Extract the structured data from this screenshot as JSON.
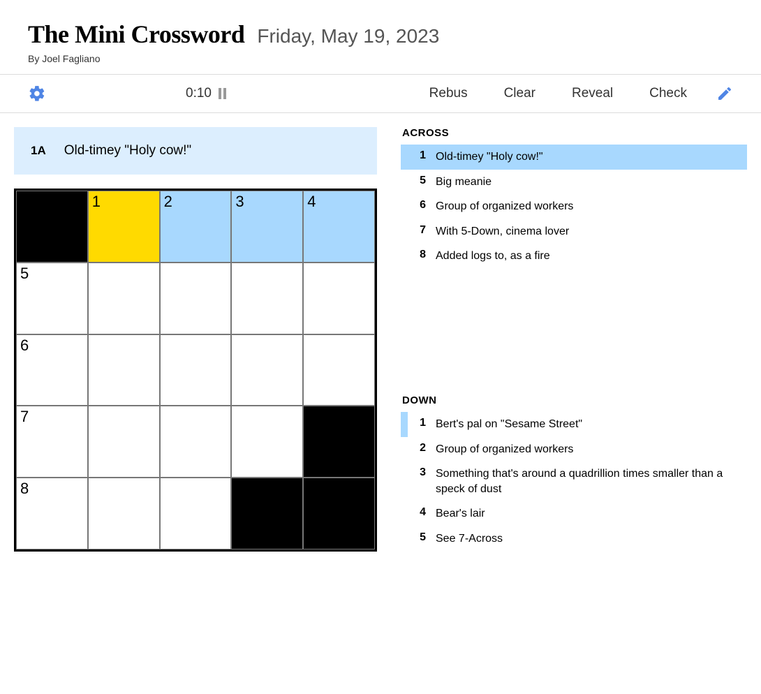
{
  "header": {
    "title": "The Mini Crossword",
    "date": "Friday, May 19, 2023",
    "byline": "By Joel Fagliano"
  },
  "toolbar": {
    "timer": "0:10",
    "menu": {
      "rebus": "Rebus",
      "clear": "Clear",
      "reveal": "Reveal",
      "check": "Check"
    }
  },
  "clue_bar": {
    "num": "1A",
    "text": "Old-timey \"Holy cow!\""
  },
  "grid": {
    "cells": [
      {
        "black": true
      },
      {
        "num": "1",
        "active": true
      },
      {
        "num": "2",
        "highlight": true
      },
      {
        "num": "3",
        "highlight": true
      },
      {
        "num": "4",
        "highlight": true
      },
      {
        "num": "5"
      },
      {},
      {},
      {},
      {},
      {
        "num": "6"
      },
      {},
      {},
      {},
      {},
      {
        "num": "7"
      },
      {},
      {},
      {},
      {
        "black": true
      },
      {
        "num": "8"
      },
      {},
      {},
      {
        "black": true
      },
      {
        "black": true
      }
    ]
  },
  "lists": {
    "across_heading": "ACROSS",
    "down_heading": "DOWN",
    "across": [
      {
        "num": "1",
        "text": "Old-timey \"Holy cow!\"",
        "selected": true
      },
      {
        "num": "5",
        "text": "Big meanie"
      },
      {
        "num": "6",
        "text": "Group of organized workers"
      },
      {
        "num": "7",
        "text": "With 5-Down, cinema lover"
      },
      {
        "num": "8",
        "text": "Added logs to, as a fire"
      }
    ],
    "down": [
      {
        "num": "1",
        "text": "Bert's pal on \"Sesame Street\"",
        "mark": true
      },
      {
        "num": "2",
        "text": "Group of organized workers"
      },
      {
        "num": "3",
        "text": "Something that's around a quadrillion times smaller than a speck of dust"
      },
      {
        "num": "4",
        "text": "Bear's lair"
      },
      {
        "num": "5",
        "text": "See 7-Across"
      }
    ]
  }
}
